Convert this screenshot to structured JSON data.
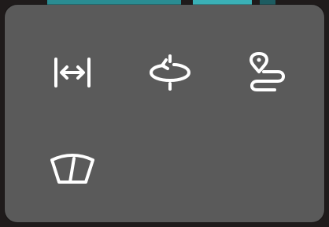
{
  "panel": {
    "tools": [
      {
        "id": "measure",
        "icon": "measure-distance-icon"
      },
      {
        "id": "orbit",
        "icon": "orbit-rotate-icon"
      },
      {
        "id": "route",
        "icon": "route-pin-icon"
      },
      {
        "id": "wiper",
        "icon": "windshield-wiper-icon"
      }
    ]
  },
  "colors": {
    "panel_background": "#5a5a5a",
    "icon_color": "#ffffff"
  }
}
